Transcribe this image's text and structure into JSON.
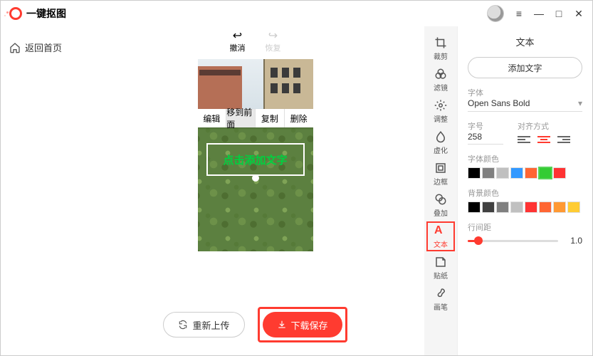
{
  "app": {
    "title": "一键抠图"
  },
  "window_controls": {
    "menu": "≡",
    "min": "—",
    "max": "□",
    "close": "✕"
  },
  "nav": {
    "back_home": "返回首页"
  },
  "history": {
    "undo": "撤消",
    "redo": "恢复"
  },
  "context_menu": {
    "edit": "编辑",
    "front": "移到前面",
    "copy": "复制",
    "delete": "删除"
  },
  "canvas": {
    "text_placeholder": "点击添加文字"
  },
  "actions": {
    "reupload": "重新上传",
    "download": "下载保存"
  },
  "tools": {
    "crop": "裁剪",
    "filter": "滤镜",
    "adjust": "调整",
    "blur": "虚化",
    "border": "边框",
    "overlay": "叠加",
    "text": "文本",
    "sticker": "贴纸",
    "brush": "画笔"
  },
  "panel": {
    "title": "文本",
    "add_text": "添加文字",
    "font_label": "字体",
    "font_value": "Open Sans Bold",
    "size_label": "字号",
    "size_value": "258",
    "align_label": "对齐方式",
    "font_color_label": "字体颜色",
    "bg_color_label": "背景颜色",
    "line_height_label": "行间距",
    "line_height_value": "1.0",
    "font_colors": [
      "#000000",
      "#808080",
      "#c0c0c0",
      "#3399ff",
      "#ff6633",
      "#33cc33",
      "#ff3333"
    ],
    "bg_colors": [
      "#000000",
      "#404040",
      "#808080",
      "#c0c0c0",
      "#ff3333",
      "#ff6633",
      "#ff9933",
      "#ffcc33"
    ]
  }
}
